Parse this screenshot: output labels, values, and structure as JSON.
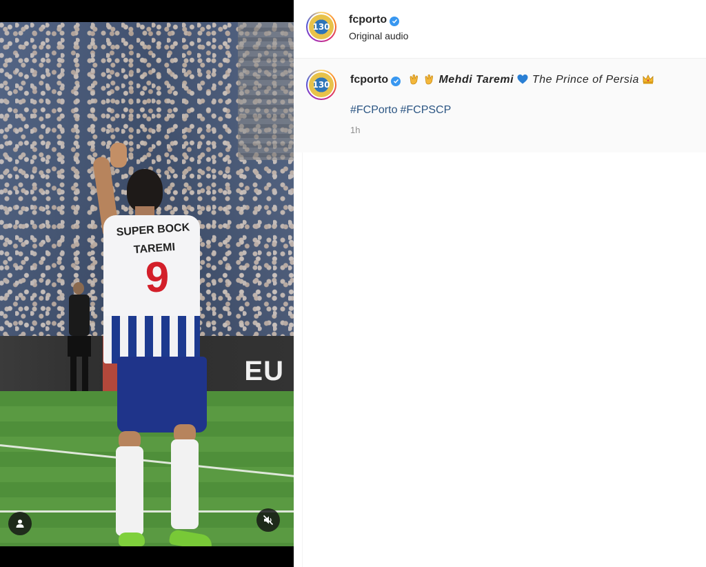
{
  "post": {
    "username": "fcporto",
    "audio": "Original audio",
    "avatar_label": "130",
    "caption": {
      "player_name": "Mehdi Taremi",
      "text": "The Prince of Persia"
    },
    "hashtags": [
      "#FCPorto",
      "#FCPSCP"
    ],
    "time": "1h"
  },
  "media": {
    "shirt_sponsor": "SUPER BOCK",
    "shirt_name": "TAREMI",
    "shirt_number": "9",
    "board_text": "EU"
  },
  "colors": {
    "verified": "#3897f0",
    "hashtag": "#2b5583",
    "muted": "#8e8e8e"
  }
}
